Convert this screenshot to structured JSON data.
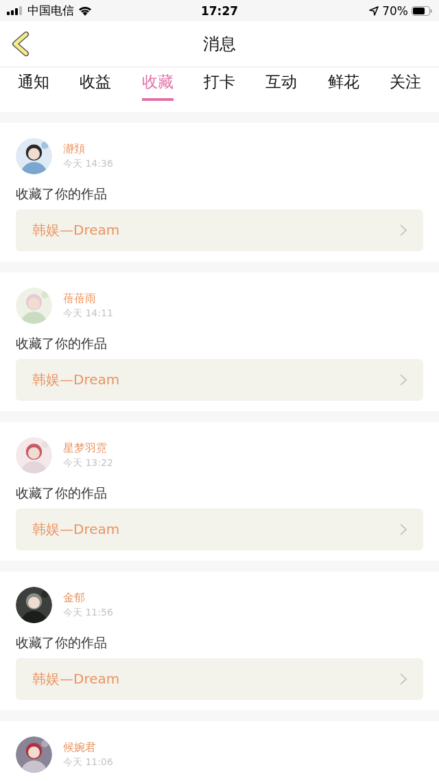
{
  "status_bar": {
    "carrier": "中国电信",
    "time": "17:27",
    "battery": "70%"
  },
  "nav": {
    "title": "消息"
  },
  "tabs": [
    {
      "label": "通知",
      "selected": false
    },
    {
      "label": "收益",
      "selected": false
    },
    {
      "label": "收藏",
      "selected": true
    },
    {
      "label": "打卡",
      "selected": false
    },
    {
      "label": "互动",
      "selected": false
    },
    {
      "label": "鲜花",
      "selected": false
    },
    {
      "label": "关注",
      "selected": false
    }
  ],
  "messages": [
    {
      "name": "瀞頚",
      "time": "今天 14:36",
      "action": "收藏了你的作品",
      "work": "韩娱—Dream"
    },
    {
      "name": "蓓蓓雨",
      "time": "今天 14:11",
      "action": "收藏了你的作品",
      "work": "韩娱—Dream"
    },
    {
      "name": "星梦羽霓",
      "time": "今天 13:22",
      "action": "收藏了你的作品",
      "work": "韩娱—Dream"
    },
    {
      "name": "金郁",
      "time": "今天 11:56",
      "action": "收藏了你的作品",
      "work": "韩娱—Dream"
    },
    {
      "name": "候婉君",
      "time": "今天 11:06"
    }
  ]
}
